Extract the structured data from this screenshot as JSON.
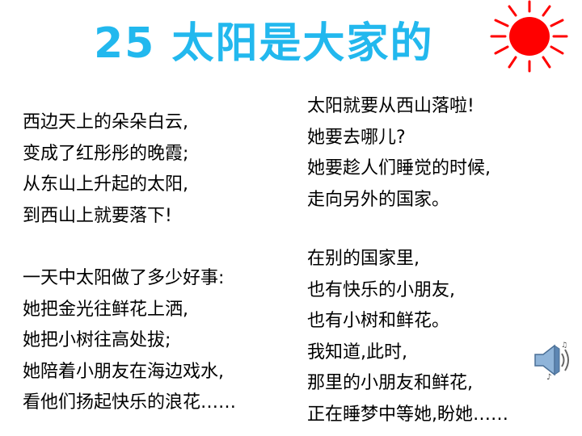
{
  "title": "25 太阳是大家的",
  "icons": {
    "sun": "sun-icon",
    "speaker": "speaker-icon"
  },
  "colors": {
    "title": "#22b8ee",
    "sun_fill": "#ff0000",
    "sun_rays": "#ff0000",
    "text": "#000000"
  },
  "poem": {
    "stanza1": [
      "西边天上的朵朵白云,",
      "变成了红彤彤的晚霞;",
      "从东山上升起的太阳,",
      "到西山上就要落下!"
    ],
    "stanza2": [
      "一天中太阳做了多少好事:",
      "她把金光往鲜花上洒,",
      "她把小树往高处拔;",
      "她陪着小朋友在海边戏水,",
      "看他们扬起快乐的浪花……"
    ],
    "stanza3": [
      "太阳就要从西山落啦!",
      "她要去哪儿?",
      "她要趁人们睡觉的时候,",
      "走向另外的国家。"
    ],
    "stanza4": [
      "在别的国家里,",
      "也有快乐的小朋友,",
      "也有小树和鲜花。",
      "我知道,此时,",
      "那里的小朋友和鲜花,",
      "正在睡梦中等她,盼她……"
    ]
  }
}
